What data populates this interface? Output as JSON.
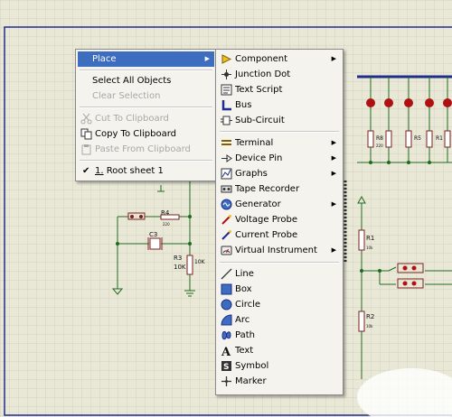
{
  "schematic": {
    "labels": {
      "r4_name": "R4",
      "r4_value": "220",
      "r3_name": "R3",
      "r3_value": "10K",
      "r3_value_side": "10K",
      "c3_name": "C3",
      "r1_name": "R1",
      "r1_value": "10k",
      "r2_name": "R2",
      "r2_value": "10k",
      "r8_name": "R8",
      "r5_name": "R5",
      "r1x_name": "R1",
      "small_val": "220"
    }
  },
  "context_menu": {
    "items": {
      "place": "Place",
      "select_all": "Select All Objects",
      "clear_selection": "Clear Selection",
      "cut": "Cut To Clipboard",
      "copy": "Copy To Clipboard",
      "paste": "Paste From Clipboard",
      "root_sheet_num": "1.",
      "root_sheet": " Root sheet 1"
    }
  },
  "place_menu": {
    "items": {
      "component": "Component",
      "junction_dot": "Junction Dot",
      "text_script": "Text Script",
      "bus": "Bus",
      "sub_circuit": "Sub-Circuit",
      "terminal": "Terminal",
      "device_pin": "Device Pin",
      "graphs": "Graphs",
      "tape_recorder": "Tape Recorder",
      "generator": "Generator",
      "voltage_probe": "Voltage Probe",
      "current_probe": "Current Probe",
      "virtual_instrument": "Virtual Instrument",
      "line": "Line",
      "box": "Box",
      "circle": "Circle",
      "arc": "Arc",
      "path": "Path",
      "text": "Text",
      "symbol": "Symbol",
      "marker": "Marker"
    }
  },
  "colors": {
    "canvas_bg": "#e9e8d7",
    "grid": "#d2d1be",
    "sheet_border": "#1f2d8c",
    "wire": "#1e6a1e",
    "component": "#7a2222",
    "label": "#111111",
    "menu_highlight": "#3d6dbf",
    "bus": "#1f2d8c",
    "led": "#b01010"
  }
}
